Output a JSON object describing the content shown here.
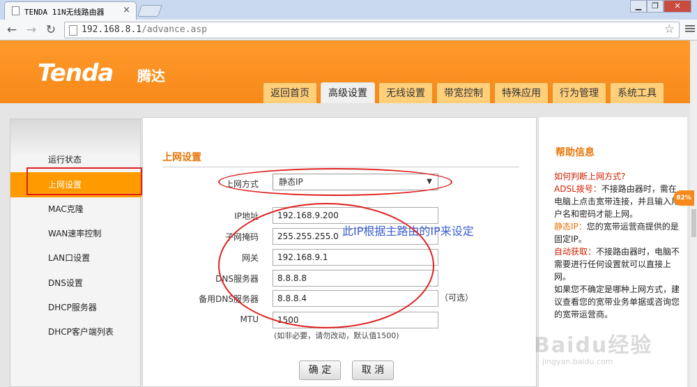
{
  "browser": {
    "tab_title": "TENDA 11N无线路由器",
    "close_glyph": "×",
    "url_host": "192.168.8.1",
    "url_path": "/advance.asp",
    "window_buttons": [
      "▁",
      "❐",
      "✕"
    ]
  },
  "header": {
    "logo": "Tenda",
    "logo_cn": "腾达",
    "tabs": [
      {
        "label": "返回首页"
      },
      {
        "label": "高级设置",
        "active": true
      },
      {
        "label": "无线设置"
      },
      {
        "label": "带宽控制"
      },
      {
        "label": "特殊应用"
      },
      {
        "label": "行为管理"
      },
      {
        "label": "系统工具"
      }
    ]
  },
  "sidebar": {
    "items": [
      {
        "label": "运行状态"
      },
      {
        "label": "上网设置",
        "active": true
      },
      {
        "label": "MAC克隆"
      },
      {
        "label": "WAN速率控制"
      },
      {
        "label": "LAN口设置"
      },
      {
        "label": "DNS设置"
      },
      {
        "label": "DHCP服务器"
      },
      {
        "label": "DHCP客户端列表"
      }
    ]
  },
  "main": {
    "section_title": "上网设置",
    "connection_type_label": "上网方式",
    "connection_type_value": "静态IP",
    "fields": {
      "ip_label": "IP地址",
      "ip_value": "192.168.9.200",
      "mask_label": "子网掩码",
      "mask_value": "255.255.255.0",
      "gateway_label": "网关",
      "gateway_value": "192.168.9.1",
      "dns_label": "DNS服务器",
      "dns_value": "8.8.8.8",
      "dns2_label": "备用DNS服务器",
      "dns2_value": "8.8.8.4",
      "dns2_optional": "（可选）",
      "mtu_label": "MTU",
      "mtu_value": "1500",
      "mtu_hint": "(如非必要，请勿改动，默认值1500)"
    },
    "annotation": "此IP根据主路由的IP来设定",
    "ok_button": "确 定",
    "cancel_button": "取 消"
  },
  "help": {
    "title": "帮助信息",
    "question": "如何判断上网方式?",
    "adsl_key": "ADSL拨号：",
    "adsl_text": "不接路由器时，需在电脑上点击宽带连接，并且输入用户名和密码才能上网。",
    "static_key": "静态IP：",
    "static_text": "您的宽带运营商提供的是固定IP。",
    "dhcp_key": "自动获取：",
    "dhcp_text": "不接路由器时，电脑不需要进行任何设置就可以直接上网。",
    "note": "如果您不确定是哪种上网方式，建议查看您的宽带业务单据或咨询您的宽带运营商。"
  },
  "overlay": {
    "badge": "82%",
    "watermark": "Baidu经验",
    "watermark_url": "jingyan.baidu.com"
  },
  "colors": {
    "accent": "#f7891a",
    "title_orange": "#e8760a",
    "sidebar_active": "#ff9b00",
    "annotation_red": "#e02020"
  }
}
